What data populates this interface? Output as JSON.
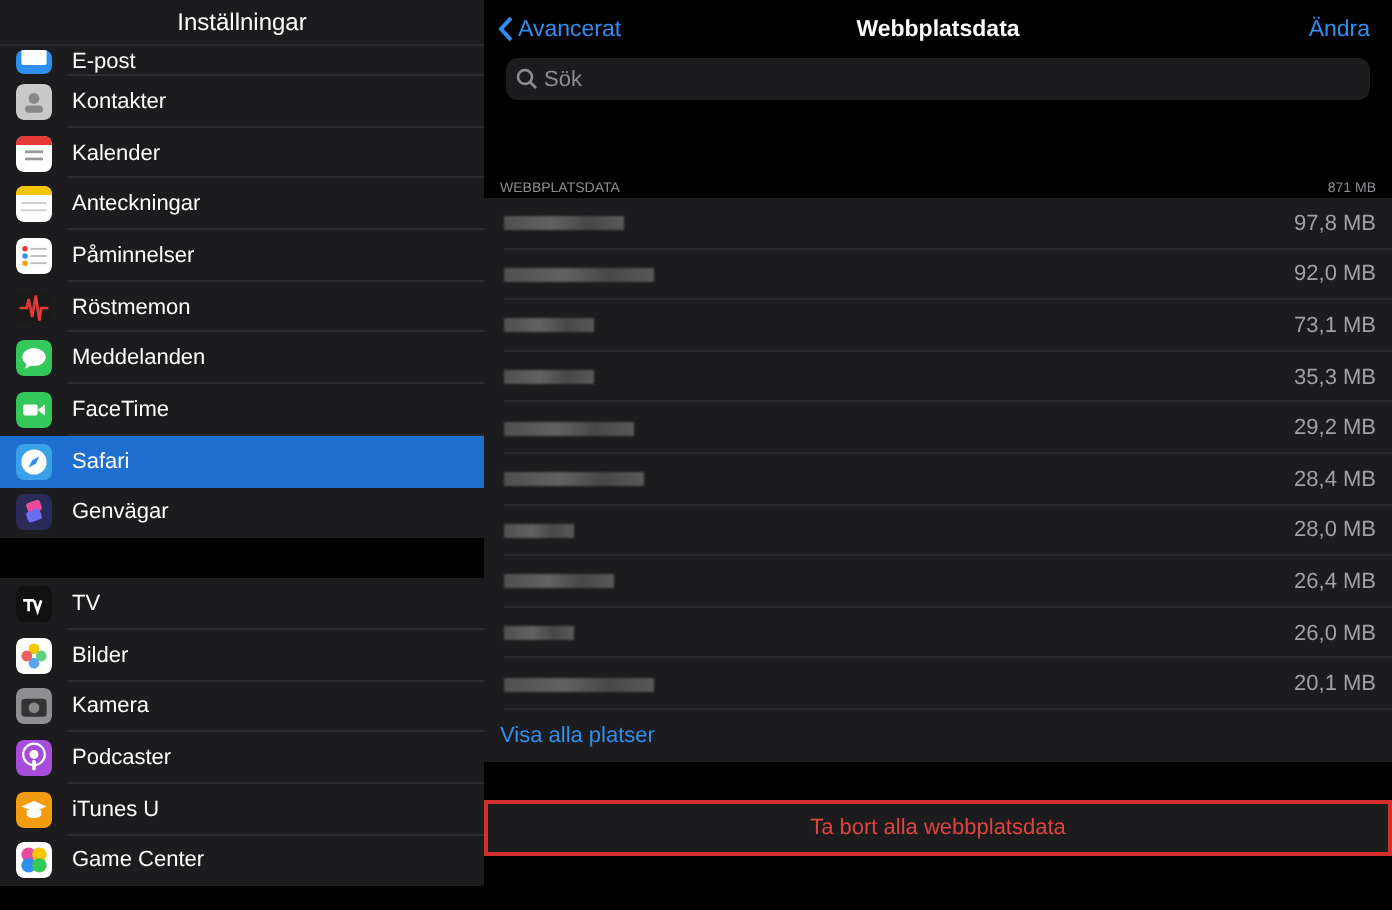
{
  "sidebar": {
    "title": "Inställningar",
    "groups": [
      [
        {
          "label": "E-post",
          "selected": false
        },
        {
          "label": "Kontakter",
          "selected": false
        },
        {
          "label": "Kalender",
          "selected": false
        },
        {
          "label": "Anteckningar",
          "selected": false
        },
        {
          "label": "Påminnelser",
          "selected": false
        },
        {
          "label": "Röstmemon",
          "selected": false
        },
        {
          "label": "Meddelanden",
          "selected": false
        },
        {
          "label": "FaceTime",
          "selected": false
        },
        {
          "label": "Safari",
          "selected": true
        },
        {
          "label": "Genvägar",
          "selected": false
        }
      ],
      [
        {
          "label": "TV",
          "selected": false
        },
        {
          "label": "Bilder",
          "selected": false
        },
        {
          "label": "Kamera",
          "selected": false
        },
        {
          "label": "Podcaster",
          "selected": false
        },
        {
          "label": "iTunes U",
          "selected": false
        },
        {
          "label": "Game Center",
          "selected": false
        }
      ]
    ]
  },
  "detail": {
    "back": "Avancerat",
    "title": "Webbplatsdata",
    "edit": "Ändra",
    "search": {
      "placeholder": "Sök"
    },
    "section": {
      "header": "WEBBPLATSDATA",
      "total": "871 MB"
    },
    "rows": [
      {
        "size": "97,8 MB"
      },
      {
        "size": "92,0 MB"
      },
      {
        "size": "73,1 MB"
      },
      {
        "size": "35,3 MB"
      },
      {
        "size": "29,2 MB"
      },
      {
        "size": "28,4 MB"
      },
      {
        "size": "28,0 MB"
      },
      {
        "size": "26,4 MB"
      },
      {
        "size": "26,0 MB"
      },
      {
        "size": "20,1 MB"
      }
    ],
    "show_all": "Visa alla platser",
    "delete": {
      "label": "Ta bort alla webbplatsdata",
      "highlighted": true
    }
  }
}
